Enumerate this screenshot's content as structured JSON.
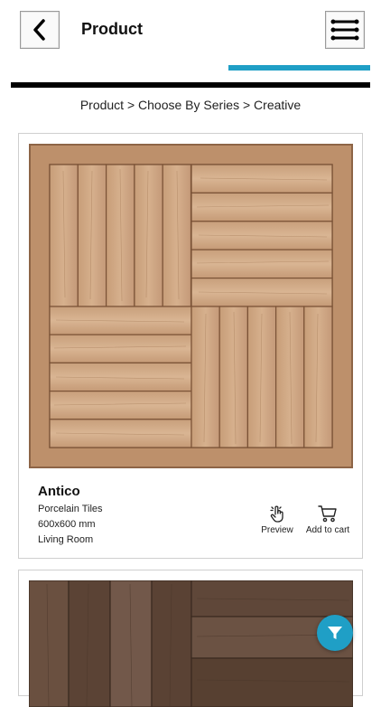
{
  "header": {
    "title": "Product",
    "back_icon": "chevron-left-icon",
    "menu_icon": "hamburger-menu-icon",
    "accent_color": "#1f9fc6"
  },
  "breadcrumb": "Product > Choose By Series > Creative",
  "products": [
    {
      "name": "Antico",
      "type": "Porcelain Tiles",
      "size": "600x600 mm",
      "room": "Living Room",
      "preview_label": "Preview",
      "cart_label": "Add to cart"
    }
  ],
  "filter_icon": "filter-icon"
}
